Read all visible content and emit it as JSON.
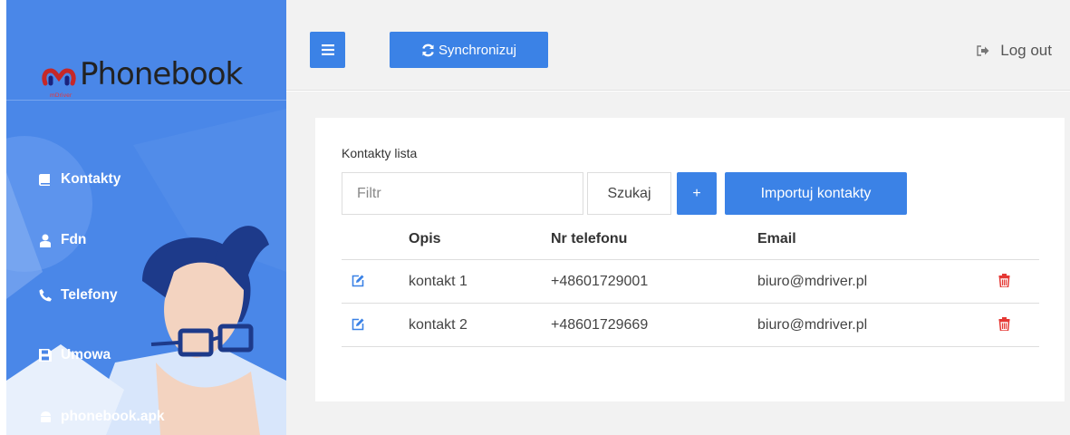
{
  "brand": {
    "name": "Phonebook",
    "sub": "mDriver"
  },
  "sidebar": {
    "items": [
      {
        "label": "Kontakty",
        "icon": "book-icon"
      },
      {
        "label": "Fdn",
        "icon": "users-icon"
      },
      {
        "label": "Telefony",
        "icon": "phone-icon"
      },
      {
        "label": "Umowa",
        "icon": "save-icon"
      },
      {
        "label": "phonebook.apk",
        "icon": "android-icon"
      }
    ]
  },
  "toolbar": {
    "menu_icon": "hamburger-icon",
    "sync_label": "Synchronizuj",
    "logout_label": "Log out"
  },
  "contacts": {
    "title": "Kontakty lista",
    "filter_placeholder": "Filtr",
    "search_label": "Szukaj",
    "add_label": "+",
    "import_label": "Importuj kontakty",
    "columns": [
      "Opis",
      "Nr telefonu",
      "Email"
    ],
    "rows": [
      {
        "opis": "kontakt 1",
        "phone": "+48601729001",
        "email": "biuro@mdriver.pl"
      },
      {
        "opis": "kontakt 2",
        "phone": "+48601729669",
        "email": "biuro@mdriver.pl"
      }
    ]
  },
  "colors": {
    "sidebar": "#4a87e8",
    "primary": "#3b82e6",
    "edit_icon": "#3b82e6",
    "delete_icon": "#e53935"
  }
}
